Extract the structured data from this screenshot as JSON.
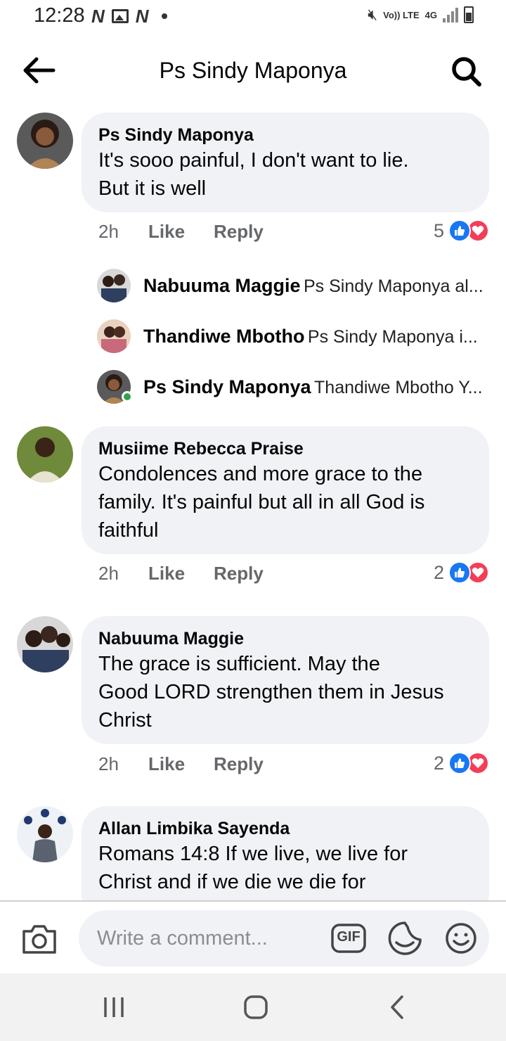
{
  "status_bar": {
    "time": "12:28",
    "left_icons": [
      "n-notification-icon",
      "image-notification-icon",
      "n-notification-icon",
      "dot-icon"
    ],
    "volte_label": "Vo)) LTE",
    "network_label": "4G",
    "right_icons": [
      "mute-icon",
      "signal-icon",
      "battery-icon"
    ]
  },
  "header": {
    "title": "Ps Sindy Maponya",
    "back_icon": "arrow-left-icon",
    "search_icon": "search-icon"
  },
  "comments": [
    {
      "author": "Ps Sindy Maponya",
      "text_lines": [
        "It's sooo painful,  I don't want to lie.",
        "But it is well"
      ],
      "time": "2h",
      "like_label": "Like",
      "reply_label": "Reply",
      "reaction_count": "5",
      "replies": [
        {
          "name": "Nabuuma Maggie",
          "preview": "Ps Sindy Maponya al..."
        },
        {
          "name": "Thandiwe Mbotho",
          "preview": "Ps Sindy Maponya i..."
        },
        {
          "name": "Ps Sindy Maponya",
          "preview": "Thandiwe Mbotho Y..."
        }
      ]
    },
    {
      "author": "Musiime Rebecca Praise",
      "text_lines": [
        "Condolences and more grace to the",
        "family. It's painful but all in all God is",
        "faithful"
      ],
      "time": "2h",
      "like_label": "Like",
      "reply_label": "Reply",
      "reaction_count": "2"
    },
    {
      "author": "Nabuuma Maggie",
      "text_lines": [
        "The grace is sufficient.  May the",
        "Good LORD strengthen them in Jesus",
        "Christ"
      ],
      "time": "2h",
      "like_label": "Like",
      "reply_label": "Reply",
      "reaction_count": "2"
    },
    {
      "author": "Allan Limbika Sayenda",
      "text_lines": [
        "Romans 14:8 If we live, we live for",
        "Christ and if we die we die for"
      ]
    }
  ],
  "composer": {
    "placeholder": "Write a comment...",
    "gif_label": "GIF"
  },
  "colors": {
    "bubble": "#f0f2f5",
    "like_blue": "#1877f2",
    "love_red": "#f33e58",
    "secondary_text": "#65676b",
    "online_green": "#31a24c"
  }
}
